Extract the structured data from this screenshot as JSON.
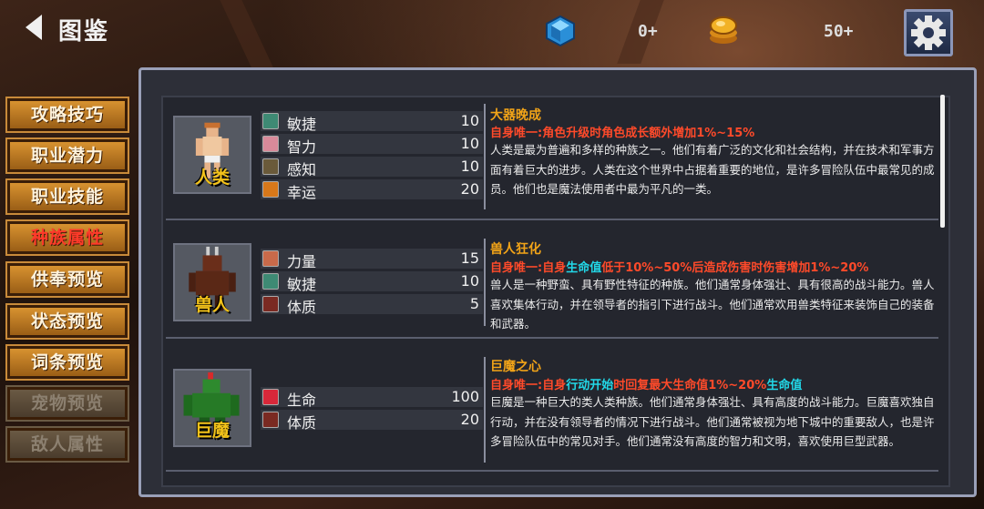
{
  "header": {
    "title": "图鉴",
    "gems": "0+",
    "coins": "50+",
    "gem_icon": "blue-gem",
    "coin_icon": "gold-coin-stack",
    "settings_icon": "gear"
  },
  "menu": [
    {
      "label": "攻略技巧",
      "state": "normal"
    },
    {
      "label": "职业潜力",
      "state": "normal"
    },
    {
      "label": "职业技能",
      "state": "normal"
    },
    {
      "label": "种族属性",
      "state": "active"
    },
    {
      "label": "供奉预览",
      "state": "normal"
    },
    {
      "label": "状态预览",
      "state": "normal"
    },
    {
      "label": "词条预览",
      "state": "normal"
    },
    {
      "label": "宠物预览",
      "state": "disabled"
    },
    {
      "label": "敌人属性",
      "state": "disabled"
    }
  ],
  "races": [
    {
      "name": "人类",
      "stats": [
        {
          "icon": "agility-icon",
          "name": "敏捷",
          "value": "10"
        },
        {
          "icon": "brain-icon",
          "name": "智力",
          "value": "10"
        },
        {
          "icon": "perception-icon",
          "name": "感知",
          "value": "10"
        },
        {
          "icon": "luck-icon",
          "name": "幸运",
          "value": "20"
        }
      ],
      "trait_title": "大器晚成",
      "trait_parts": [
        {
          "text": "自身唯一:角色升级时角色成长额外增加1%~15%",
          "color": "red"
        }
      ],
      "description": "人类是最为普遍和多样的种族之一。他们有着广泛的文化和社会结构，并在技术和军事方面有着巨大的进步。人类在这个世界中占据着重要的地位，是许多冒险队伍中最常见的成员。他们也是魔法使用者中最为平凡的一类。"
    },
    {
      "name": "兽人",
      "stats": [
        {
          "icon": "strength-icon",
          "name": "力量",
          "value": "15"
        },
        {
          "icon": "agility-icon",
          "name": "敏捷",
          "value": "10"
        },
        {
          "icon": "constitution-icon",
          "name": "体质",
          "value": "5"
        }
      ],
      "trait_title": "兽人狂化",
      "trait_parts": [
        {
          "text": "自身唯一:自身",
          "color": "red"
        },
        {
          "text": "生命值",
          "color": "cyan"
        },
        {
          "text": "低于10%~50%后造成伤害时伤害增加1%~20%",
          "color": "red"
        }
      ],
      "description": "兽人是一种野蛮、具有野性特征的种族。他们通常身体强壮、具有很高的战斗能力。兽人喜欢集体行动，并在领导者的指引下进行战斗。他们通常欢用兽类特征来装饰自己的装备和武器。"
    },
    {
      "name": "巨魔",
      "stats": [
        {
          "icon": "heart-icon",
          "name": "生命",
          "value": "100"
        },
        {
          "icon": "constitution-icon",
          "name": "体质",
          "value": "20"
        }
      ],
      "trait_title": "巨魔之心",
      "trait_parts": [
        {
          "text": "自身唯一:自身",
          "color": "red"
        },
        {
          "text": "行动开始",
          "color": "cyan"
        },
        {
          "text": "时回复最大生命值1%~20%",
          "color": "red"
        },
        {
          "text": "生命值",
          "color": "cyan"
        }
      ],
      "description": "巨魔是一种巨大的类人类种族。他们通常身体强壮、具有高度的战斗能力。巨魔喜欢独自行动，并在没有领导者的情况下进行战斗。他们通常被视为地下城中的重要敌人，也是许多冒险队伍中的常见对手。他们通常没有高度的智力和文明，喜欢使用巨型武器。"
    }
  ],
  "colors": {
    "accent_orange": "#f2a418",
    "trait_red": "#ff4a2a",
    "trait_cyan": "#22d8e8",
    "race_name_gold": "#f2c21a"
  }
}
